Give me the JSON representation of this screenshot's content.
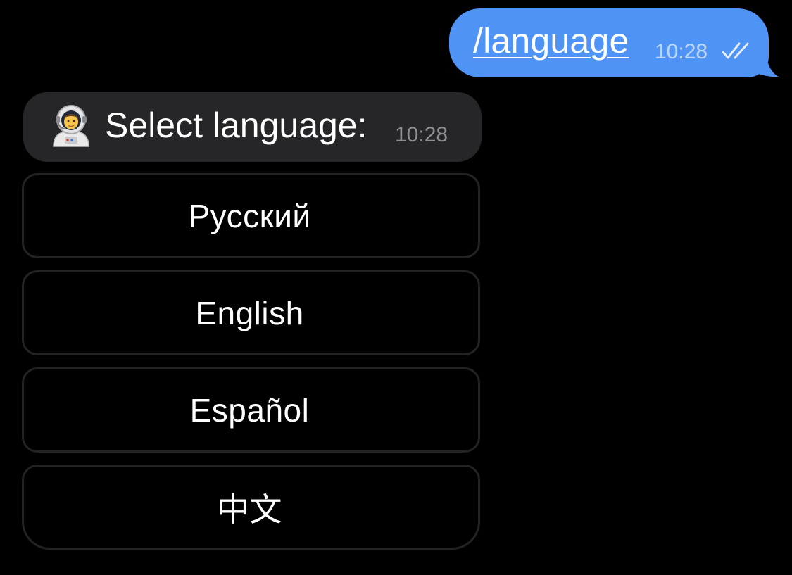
{
  "outgoing_message": {
    "text": "/language",
    "time": "10:28",
    "status_icon": "double-check-icon",
    "bubble_color": "#4f93f5"
  },
  "incoming_message": {
    "emoji_icon": "astronaut-emoji-icon",
    "text": "Select language:",
    "time": "10:28",
    "bubble_color": "#262628"
  },
  "keyboard": {
    "buttons": [
      {
        "label": "Русский"
      },
      {
        "label": "English"
      },
      {
        "label": "Español"
      },
      {
        "label": "中文"
      }
    ]
  }
}
